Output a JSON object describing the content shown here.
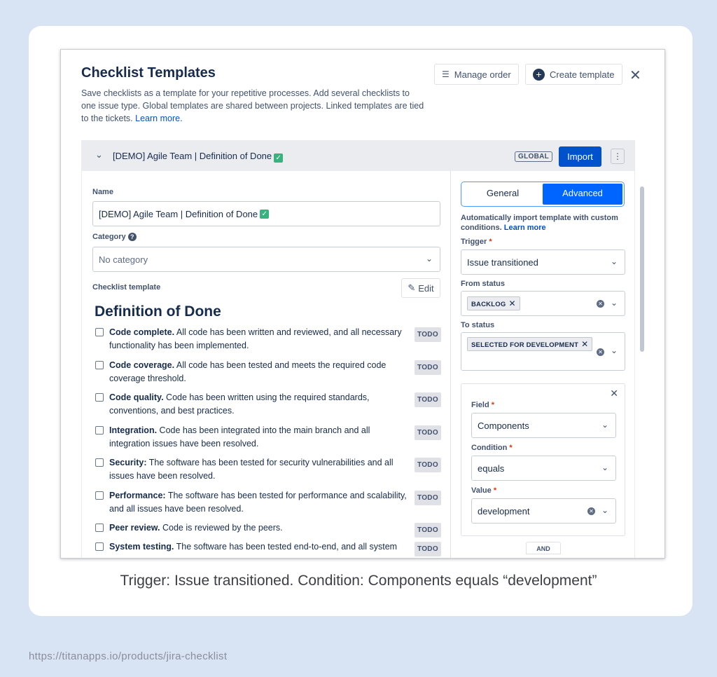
{
  "header": {
    "title": "Checklist Templates",
    "description": "Save checklists as a template for your repetitive processes. Add several checklists to one issue type. Global templates are shared between projects. Linked templates are tied to the tickets.",
    "learn_more": "Learn more.",
    "manage_order": "Manage order",
    "create_template": "Create template",
    "close": "✕"
  },
  "template": {
    "title": "[DEMO] Agile Team | Definition of Done",
    "badge": "GLOBAL",
    "import": "Import",
    "more": "⋮"
  },
  "form": {
    "name_label": "Name",
    "name_value": "[DEMO] Agile Team | Definition of Done",
    "category_label": "Category",
    "category_value": "No category",
    "checklist_label": "Checklist template",
    "edit": "Edit",
    "heading": "Definition of Done",
    "items": [
      {
        "bold": "Code complete.",
        "text": " All code has been written and reviewed, and all necessary functionality has been implemented.",
        "status": "TODO"
      },
      {
        "bold": "Code coverage.",
        "text": " All code has been tested and meets the required code coverage threshold.",
        "status": "TODO"
      },
      {
        "bold": "Code quality.",
        "text": " Code has been written using the required standards, conventions, and best practices.",
        "status": "TODO"
      },
      {
        "bold": "Integration.",
        "text": " Code has been integrated into the main branch and all integration issues have been resolved.",
        "status": "TODO"
      },
      {
        "bold": "Security:",
        "text": " The software has been tested for security vulnerabilities and all issues have been resolved.",
        "status": "TODO"
      },
      {
        "bold": "Performance:",
        "text": " The software has been tested for performance and scalability, and all issues have been resolved.",
        "status": "TODO"
      },
      {
        "bold": "Peer review.",
        "text": " Code is reviewed by the peers.",
        "status": "TODO"
      },
      {
        "bold": "System testing.",
        "text": " The software has been tested end-to-end, and all system",
        "status": "TODO"
      }
    ]
  },
  "settings": {
    "tab_general": "General",
    "tab_advanced": "Advanced",
    "info": "Automatically import template with custom conditions.",
    "info_link": "Learn more",
    "trigger_label": "Trigger",
    "trigger_value": "Issue transitioned",
    "from_label": "From status",
    "from_chip": "BACKLOG",
    "to_label": "To status",
    "to_chip": "SELECTED FOR DEVELOPMENT",
    "field_label": "Field",
    "field_value": "Components",
    "condition_label": "Condition",
    "condition_value": "equals",
    "value_label": "Value",
    "value_value": "development",
    "and_label": "AND",
    "required_mark": "*"
  },
  "caption": "Trigger: Issue transitioned. Condition: Components equals “development”",
  "source_url": "https://titanapps.io/products/jira-checklist",
  "colors": {
    "accent": "#0052cc",
    "bg": "#d8e3f4"
  }
}
